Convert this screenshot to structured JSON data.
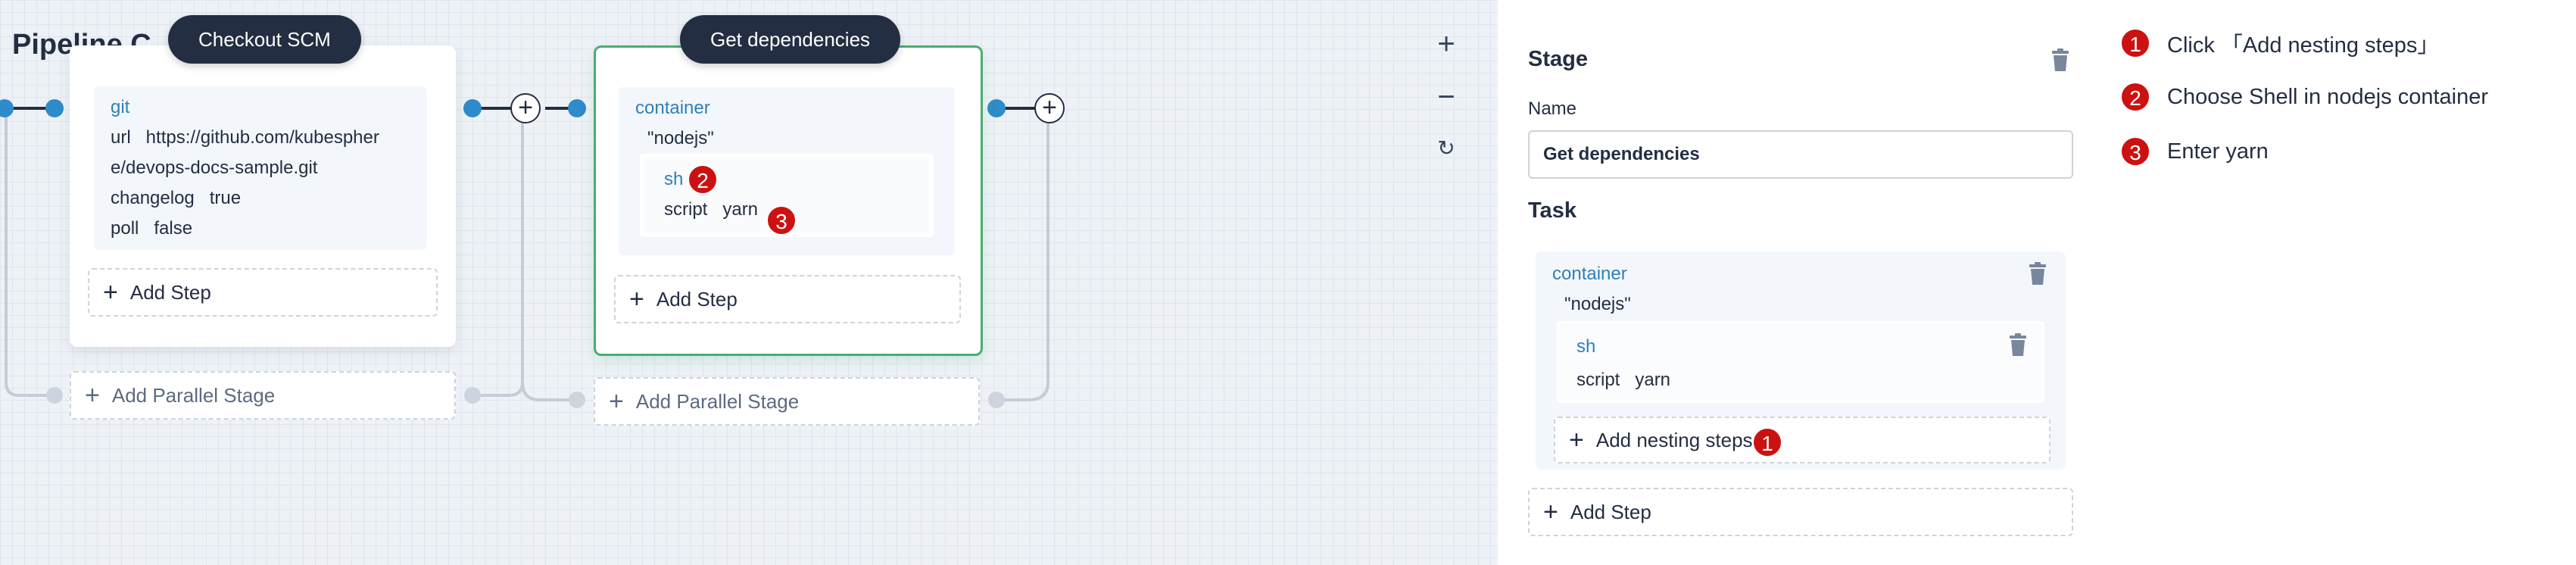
{
  "page": {
    "title": "Pipeline C"
  },
  "canvas": {
    "zoom_in_icon": "plus-icon",
    "zoom_out_icon": "minus-icon",
    "reset_icon": "refresh-icon",
    "stages": [
      {
        "name": "Checkout SCM",
        "step": {
          "name": "git",
          "params": [
            {
              "key": "url",
              "value": "https://github.com/kubespher"
            },
            {
              "key": "",
              "value": "e/devops-docs-sample.git"
            },
            {
              "key": "changelog",
              "value": "true"
            },
            {
              "key": "poll",
              "value": "false"
            }
          ]
        },
        "add_step_label": "Add Step",
        "add_parallel_label": "Add Parallel Stage"
      },
      {
        "name": "Get dependencies",
        "step": {
          "name": "container",
          "arg": "\"nodejs\"",
          "nested": {
            "name": "sh",
            "badge": "2",
            "param_key": "script",
            "param_value": "yarn",
            "badge2": "3"
          }
        },
        "add_step_label": "Add Step",
        "add_parallel_label": "Add Parallel Stage"
      }
    ]
  },
  "panel": {
    "stage_heading": "Stage",
    "name_label": "Name",
    "name_value": "Get dependencies",
    "task_heading": "Task",
    "task": {
      "name": "container",
      "arg": "\"nodejs\"",
      "nested_name": "sh",
      "nested_param_key": "script",
      "nested_param_value": "yarn",
      "add_nesting_label": "Add nesting steps",
      "add_nesting_badge": "1"
    },
    "add_step_label": "Add Step"
  },
  "instructions": [
    {
      "num": "1",
      "text": "Click 「Add nesting steps」"
    },
    {
      "num": "2",
      "text": "Choose Shell in nodejs container"
    },
    {
      "num": "3",
      "text": "Enter yarn"
    }
  ],
  "colors": {
    "accent_blue": "#2f7fb7",
    "active_border": "#4aae71",
    "badge_red": "#cc1111",
    "pill_dark": "#242e42",
    "node_blue": "#2f8bc9"
  }
}
